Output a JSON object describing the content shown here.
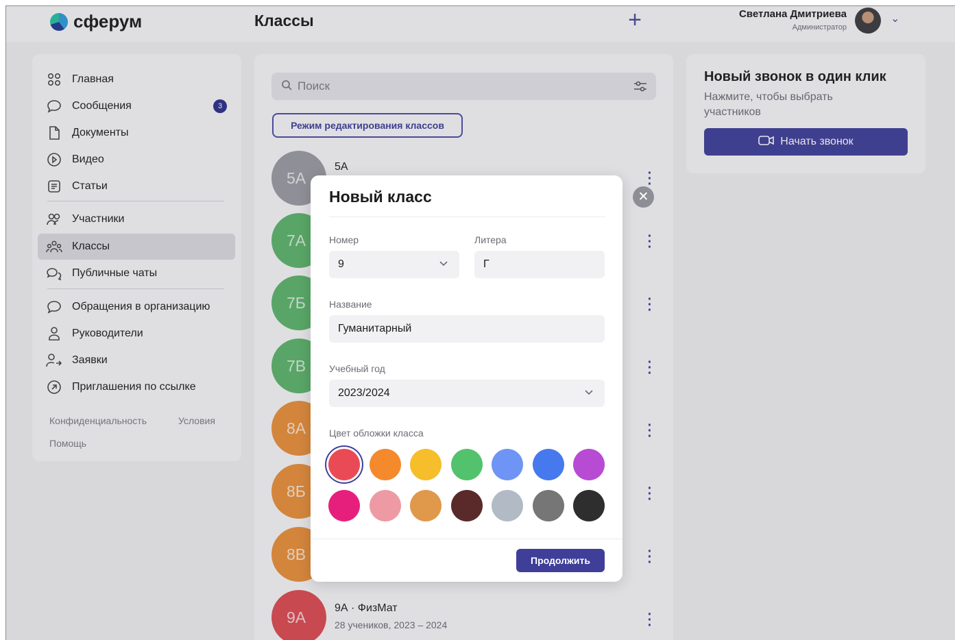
{
  "header": {
    "logo_text": "сферум",
    "page_title": "Классы",
    "add_icon": "plus-icon",
    "user_name": "Светлана Дмитриева",
    "user_role": "Администратор"
  },
  "sidebar": {
    "items": [
      {
        "label": "Главная",
        "icon": "grid-icon"
      },
      {
        "label": "Сообщения",
        "icon": "chat-bubble-icon",
        "badge": "3"
      },
      {
        "label": "Документы",
        "icon": "document-icon"
      },
      {
        "label": "Видео",
        "icon": "play-circle-icon"
      },
      {
        "label": "Статьи",
        "icon": "article-icon"
      },
      {
        "label": "Участники",
        "icon": "people-icon"
      },
      {
        "label": "Классы",
        "icon": "group-icon",
        "active": true
      },
      {
        "label": "Публичные чаты",
        "icon": "chats-icon"
      },
      {
        "label": "Обращения в организацию",
        "icon": "chat-bubble-icon"
      },
      {
        "label": "Руководители",
        "icon": "person-icon"
      },
      {
        "label": "Заявки",
        "icon": "person-arrow-icon"
      },
      {
        "label": "Приглашения по ссылке",
        "icon": "arrow-circle-icon"
      }
    ],
    "footer": {
      "privacy": "Конфиденциальность",
      "terms": "Условия",
      "help": "Помощь"
    }
  },
  "main": {
    "search_placeholder": "Поиск",
    "edit_mode_label": "Режим редактирования классов",
    "classes": [
      {
        "avatar": "5А",
        "color": "#9a9aa2",
        "name": "5А",
        "sub": ""
      },
      {
        "avatar": "7А",
        "color": "#5cb46b",
        "name": "",
        "sub": ""
      },
      {
        "avatar": "7Б",
        "color": "#5cb46b",
        "name": "",
        "sub": ""
      },
      {
        "avatar": "7В",
        "color": "#5cb46b",
        "name": "",
        "sub": ""
      },
      {
        "avatar": "8А",
        "color": "#e98f3a",
        "name": "",
        "sub": ""
      },
      {
        "avatar": "8Б",
        "color": "#e98f3a",
        "name": "",
        "sub": ""
      },
      {
        "avatar": "8В",
        "color": "#e98f3a",
        "name": "",
        "sub": ""
      },
      {
        "avatar": "9А",
        "color": "#dd4a52",
        "name": "9А · ФизМат",
        "sub": "28 учеников,  2023 – 2024"
      }
    ]
  },
  "call": {
    "title": "Новый звонок в один клик",
    "subtitle": "Нажмите, чтобы выбрать участников",
    "button": "Начать звонок"
  },
  "modal": {
    "title": "Новый класс",
    "number_label": "Номер",
    "number_value": "9",
    "letter_label": "Литера",
    "letter_value": "Г",
    "name_label": "Название",
    "name_value": "Гуманитарный",
    "year_label": "Учебный год",
    "year_value": "2023/2024",
    "color_label": "Цвет обложки класса",
    "colors": [
      "#ea4a55",
      "#f48a2c",
      "#f5be2a",
      "#53c26c",
      "#6e95f5",
      "#4679ee",
      "#b84bd4",
      "#e71f7c",
      "#ee9aa5",
      "#e0984a",
      "#5a2a2a",
      "#b1bac5",
      "#767676",
      "#2e2e2e"
    ],
    "selected_color": "#ea4a55",
    "continue_label": "Продолжить"
  }
}
